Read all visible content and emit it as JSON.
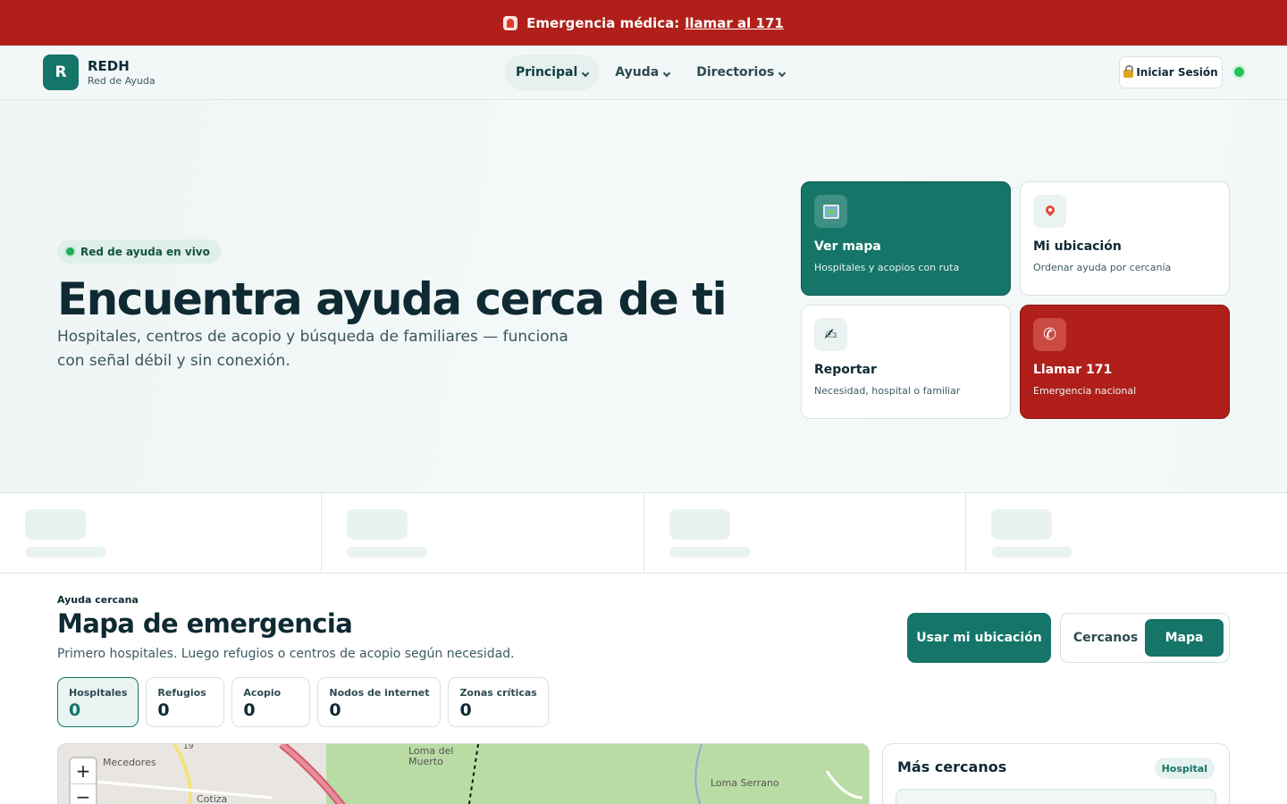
{
  "emergency": {
    "text": "Emergencia médica:",
    "link": "llamar al 171"
  },
  "brand": {
    "logo_letter": "R",
    "name": "REDH",
    "subtitle": "Red de Ayuda"
  },
  "nav": [
    {
      "label": "Principal",
      "active": true
    },
    {
      "label": "Ayuda",
      "active": false
    },
    {
      "label": "Directorios",
      "active": false
    }
  ],
  "header": {
    "login_label": "Iniciar Sesión",
    "status": "online"
  },
  "hero": {
    "pill": "Red de ayuda en vivo",
    "title": "Encuentra ayuda cerca de ti",
    "subtitle": "Hospitales, centros de acopio y búsqueda de familiares — funciona con señal débil y sin conexión."
  },
  "quick_actions": [
    {
      "title": "Ver mapa",
      "subtitle": "Hospitales y acopios con ruta",
      "icon": "map-icon"
    },
    {
      "title": "Mi ubicación",
      "subtitle": "Ordenar ayuda por cercanía",
      "icon": "pin-icon"
    },
    {
      "title": "Reportar",
      "subtitle": "Necesidad, hospital o familiar",
      "icon": "writing-hand-icon"
    },
    {
      "title": "Llamar 171",
      "subtitle": "Emergencia nacional",
      "icon": "phone-icon"
    }
  ],
  "map_section": {
    "eyebrow": "Ayuda cercana",
    "title": "Mapa de emergencia",
    "subtitle": "Primero hospitales. Luego refugios o centros de acopio según necesidad.",
    "use_location": "Usar mi ubicación",
    "view_toggle": [
      "Cercanos",
      "Mapa"
    ],
    "view_selected": "Mapa"
  },
  "filters": [
    {
      "label": "Hospitales",
      "count": "0",
      "active": true
    },
    {
      "label": "Refugios",
      "count": "0",
      "active": false
    },
    {
      "label": "Acopio",
      "count": "0",
      "active": false
    },
    {
      "label": "Nodos de internet",
      "count": "0",
      "active": false
    },
    {
      "label": "Zonas críticas",
      "count": "0",
      "active": false
    }
  ],
  "map": {
    "zoom_in": "+",
    "zoom_out": "−",
    "labels": [
      "Mecedores",
      "Cotiza",
      "Loma del Muerto",
      "Loma Serrano",
      "19"
    ]
  },
  "nearest": {
    "title": "Más cercanos",
    "badge": "Hospital"
  },
  "colors": {
    "primary": "#147568",
    "danger": "#b01f1a",
    "online": "#24c25a"
  }
}
